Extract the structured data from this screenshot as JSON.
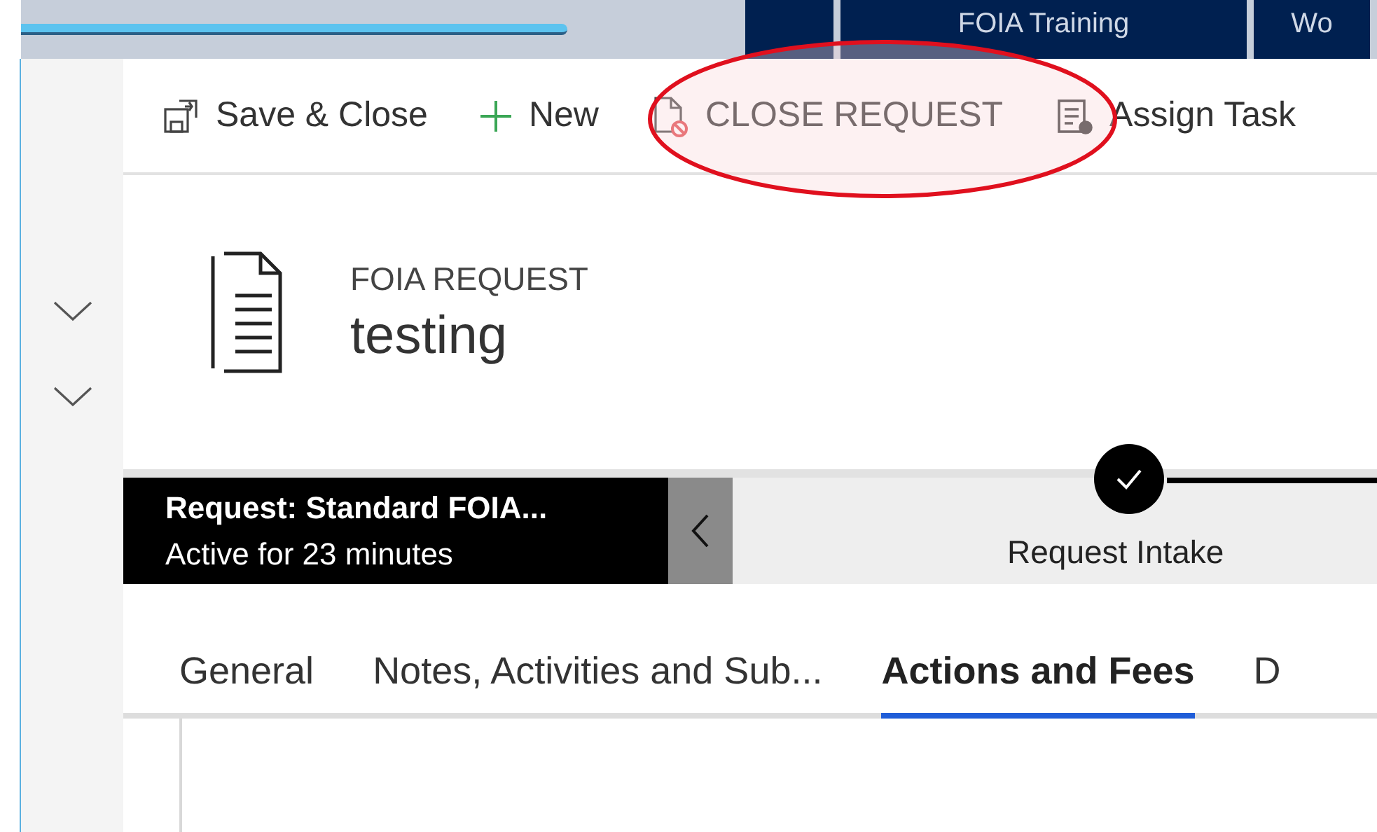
{
  "app_tabs": [
    {
      "label": "FOIA Training"
    },
    {
      "label": "Wo"
    }
  ],
  "commands": [
    {
      "kind": "save",
      "label": "Save & Close"
    },
    {
      "kind": "new",
      "label": "New"
    },
    {
      "kind": "close",
      "label": "CLOSE REQUEST"
    },
    {
      "kind": "assign",
      "label": "Assign Task"
    }
  ],
  "record": {
    "type": "FOIA REQUEST",
    "name": "testing"
  },
  "process": {
    "title": "Request: Standard FOIA...",
    "duration": "Active for 23 minutes",
    "stage": {
      "label": "Request Intake",
      "completed": true
    }
  },
  "tabs": [
    {
      "label": "General",
      "selected": false
    },
    {
      "label": "Notes, Activities and Sub...",
      "selected": false
    },
    {
      "label": "Actions and Fees",
      "selected": true
    },
    {
      "label": "D",
      "selected": false
    }
  ]
}
